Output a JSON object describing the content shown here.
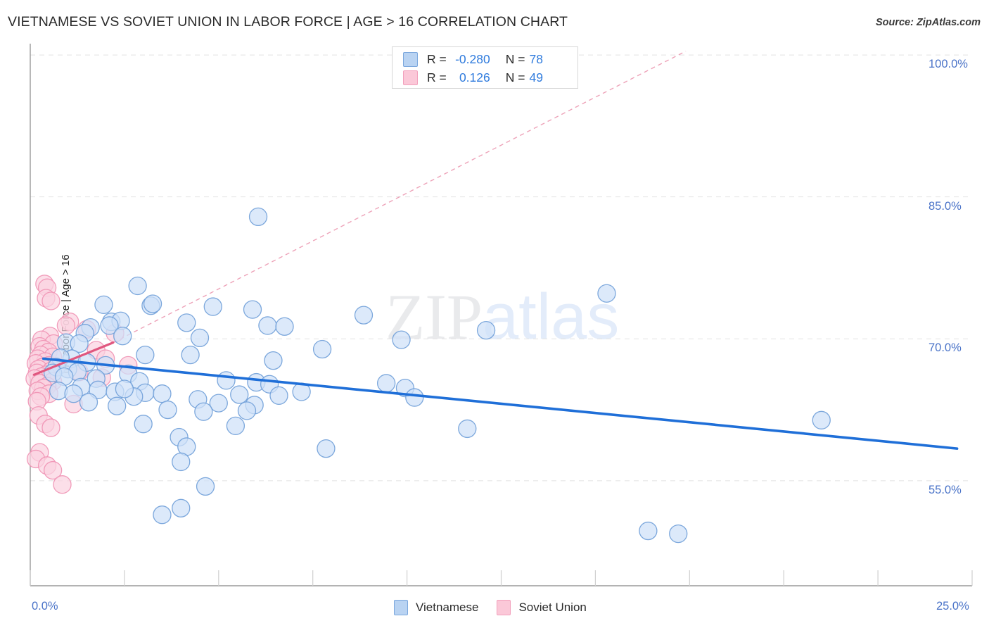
{
  "header": {
    "title": "VIETNAMESE VS SOVIET UNION IN LABOR FORCE | AGE > 16 CORRELATION CHART",
    "source": "Source: ZipAtlas.com"
  },
  "watermark": {
    "part1": "ZIP",
    "part2": "atlas"
  },
  "stats": {
    "series1": {
      "r_label": "R =",
      "r_value": "-0.280",
      "n_label": "N =",
      "n_value": "78"
    },
    "series2": {
      "r_label": "R =",
      "r_value": "0.126",
      "n_label": "N =",
      "n_value": "49"
    }
  },
  "legend": {
    "items": [
      {
        "label": "Vietnamese",
        "color": "#b9d3f2"
      },
      {
        "label": "Soviet Union",
        "color": "#fbc8d8"
      }
    ]
  },
  "chart_data": {
    "type": "scatter",
    "title": "VIETNAMESE VS SOVIET UNION IN LABOR FORCE | AGE > 16 CORRELATION CHART",
    "xlabel": "",
    "ylabel": "In Labor Force | Age > 16",
    "xlim": [
      0,
      25
    ],
    "ylim": [
      43.9,
      100.9
    ],
    "x_ticks": [
      0,
      25
    ],
    "x_tick_labels": [
      "0.0%",
      "25.0%"
    ],
    "y_ticks": [
      55,
      70,
      85,
      100
    ],
    "y_tick_labels": [
      "55.0%",
      "70.0%",
      "85.0%",
      "100.0%"
    ],
    "grid": "horizontal-dashed",
    "legend_position": "bottom-center",
    "colors": {
      "series1_fill": "#cfe1f8",
      "series1_stroke": "#6f9fd8",
      "series1_trend": "#1f6fd8",
      "series2_fill": "#fbd3e0",
      "series2_stroke": "#f092b4",
      "series2_trend": "#e0577f",
      "tick_text": "#4a73c8",
      "axis": "#9a9a9a"
    },
    "series": [
      {
        "name": "Vietnamese",
        "r": -0.28,
        "n": 78,
        "trend": {
          "style": "solid",
          "x0": 0.35,
          "y0": 67.9,
          "x1": 24.6,
          "y1": 58.4
        },
        "points": [
          [
            6.05,
            82.9
          ],
          [
            2.85,
            75.6
          ],
          [
            15.3,
            74.8
          ],
          [
            1.95,
            73.6
          ],
          [
            3.2,
            73.5
          ],
          [
            3.25,
            73.7
          ],
          [
            4.85,
            73.4
          ],
          [
            5.9,
            73.1
          ],
          [
            8.85,
            72.5
          ],
          [
            2.15,
            71.8
          ],
          [
            2.4,
            71.9
          ],
          [
            4.15,
            71.7
          ],
          [
            2.1,
            71.4
          ],
          [
            1.6,
            71.2
          ],
          [
            6.3,
            71.4
          ],
          [
            6.75,
            71.3
          ],
          [
            12.1,
            70.9
          ],
          [
            1.45,
            70.6
          ],
          [
            2.45,
            70.3
          ],
          [
            4.5,
            70.1
          ],
          [
            9.85,
            69.9
          ],
          [
            0.95,
            69.6
          ],
          [
            1.3,
            69.5
          ],
          [
            7.75,
            68.9
          ],
          [
            3.05,
            68.3
          ],
          [
            4.25,
            68.3
          ],
          [
            6.45,
            67.7
          ],
          [
            1.1,
            67.9
          ],
          [
            0.8,
            68.0
          ],
          [
            1.5,
            67.5
          ],
          [
            2.0,
            67.2
          ],
          [
            0.7,
            67.0
          ],
          [
            1.0,
            66.8
          ],
          [
            1.25,
            66.5
          ],
          [
            2.6,
            66.3
          ],
          [
            0.6,
            66.4
          ],
          [
            0.9,
            66.0
          ],
          [
            1.75,
            65.8
          ],
          [
            2.9,
            65.5
          ],
          [
            5.2,
            65.6
          ],
          [
            6.0,
            65.4
          ],
          [
            6.35,
            65.2
          ],
          [
            9.45,
            65.3
          ],
          [
            9.95,
            64.8
          ],
          [
            1.35,
            64.9
          ],
          [
            1.8,
            64.6
          ],
          [
            2.25,
            64.4
          ],
          [
            3.05,
            64.3
          ],
          [
            3.5,
            64.2
          ],
          [
            5.55,
            64.1
          ],
          [
            6.6,
            64.0
          ],
          [
            0.75,
            64.5
          ],
          [
            1.15,
            64.2
          ],
          [
            2.75,
            63.9
          ],
          [
            4.45,
            63.6
          ],
          [
            5.0,
            63.2
          ],
          [
            5.95,
            63.0
          ],
          [
            1.55,
            63.3
          ],
          [
            2.3,
            62.9
          ],
          [
            3.65,
            62.5
          ],
          [
            4.6,
            62.3
          ],
          [
            5.75,
            62.4
          ],
          [
            21.0,
            61.4
          ],
          [
            3.0,
            61.0
          ],
          [
            5.45,
            60.8
          ],
          [
            11.6,
            60.5
          ],
          [
            3.95,
            59.6
          ],
          [
            4.15,
            58.6
          ],
          [
            7.85,
            58.4
          ],
          [
            4.0,
            57.0
          ],
          [
            4.65,
            54.4
          ],
          [
            4.0,
            52.1
          ],
          [
            3.5,
            51.4
          ],
          [
            16.4,
            49.7
          ],
          [
            17.2,
            49.4
          ],
          [
            2.5,
            64.7
          ],
          [
            7.2,
            64.4
          ],
          [
            10.2,
            63.8
          ]
        ]
      },
      {
        "name": "Soviet Union",
        "r": 0.126,
        "n": 49,
        "trend": {
          "style": "solid",
          "x0": 0.1,
          "y0": 66.2,
          "x1": 2.2,
          "y1": 69.6
        },
        "trend_extension": {
          "style": "dashed",
          "x0": 2.2,
          "y0": 69.6,
          "x1": 17.4,
          "y1": 100.4
        },
        "points": [
          [
            0.38,
            75.8
          ],
          [
            0.45,
            75.4
          ],
          [
            0.42,
            74.3
          ],
          [
            0.55,
            74.0
          ],
          [
            1.05,
            71.8
          ],
          [
            0.95,
            71.4
          ],
          [
            1.5,
            71.0
          ],
          [
            2.25,
            70.6
          ],
          [
            0.52,
            70.3
          ],
          [
            0.3,
            69.9
          ],
          [
            0.62,
            69.5
          ],
          [
            0.25,
            69.2
          ],
          [
            0.35,
            68.9
          ],
          [
            0.48,
            68.6
          ],
          [
            0.28,
            68.3
          ],
          [
            0.6,
            68.1
          ],
          [
            0.2,
            67.9
          ],
          [
            0.4,
            67.6
          ],
          [
            0.15,
            67.4
          ],
          [
            0.5,
            67.2
          ],
          [
            0.32,
            67.0
          ],
          [
            0.22,
            66.8
          ],
          [
            0.55,
            66.6
          ],
          [
            0.18,
            66.4
          ],
          [
            0.42,
            66.2
          ],
          [
            0.3,
            66.0
          ],
          [
            0.12,
            65.8
          ],
          [
            0.6,
            65.5
          ],
          [
            0.25,
            65.3
          ],
          [
            0.45,
            65.0
          ],
          [
            1.75,
            68.8
          ],
          [
            2.0,
            67.9
          ],
          [
            2.6,
            67.2
          ],
          [
            1.3,
            66.5
          ],
          [
            1.9,
            65.9
          ],
          [
            0.35,
            64.8
          ],
          [
            0.2,
            64.5
          ],
          [
            0.5,
            64.2
          ],
          [
            0.28,
            63.9
          ],
          [
            0.18,
            63.4
          ],
          [
            1.15,
            63.1
          ],
          [
            0.22,
            61.9
          ],
          [
            0.4,
            61.0
          ],
          [
            0.55,
            60.6
          ],
          [
            0.25,
            58.0
          ],
          [
            0.15,
            57.3
          ],
          [
            0.45,
            56.6
          ],
          [
            0.6,
            56.1
          ],
          [
            0.85,
            54.6
          ]
        ]
      }
    ]
  }
}
